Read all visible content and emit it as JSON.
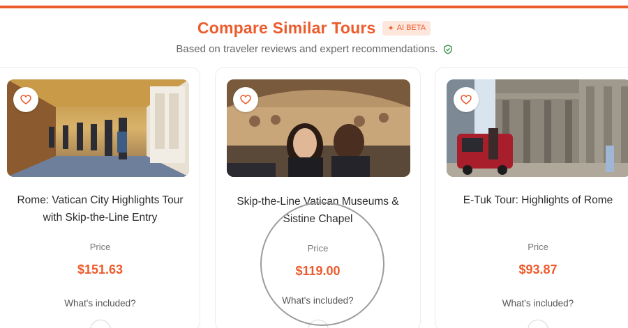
{
  "header": {
    "title": "Compare Similar Tours",
    "badge_label": "AI BETA",
    "subtitle": "Based on traveler reviews and expert recommendations."
  },
  "labels": {
    "price": "Price",
    "whats_included": "What's included?"
  },
  "cards": [
    {
      "title": "Rome: Vatican City Highlights Tour with Skip-the-Line Entry",
      "price": "$151.63",
      "image_alt": "Vatican gallery corridor with tourists"
    },
    {
      "title": "Skip-the-Line Vatican Museums & Sistine Chapel",
      "price": "$119.00",
      "image_alt": "Visitors looking up at frescoes"
    },
    {
      "title": "E-Tuk Tour: Highlights of Rome",
      "price": "$93.87",
      "image_alt": "Tuk-tuk in front of the Pantheon"
    }
  ],
  "colors": {
    "accent": "#ec5b2c",
    "badge_bg": "#fde6dc",
    "verified": "#3a8f4a"
  }
}
